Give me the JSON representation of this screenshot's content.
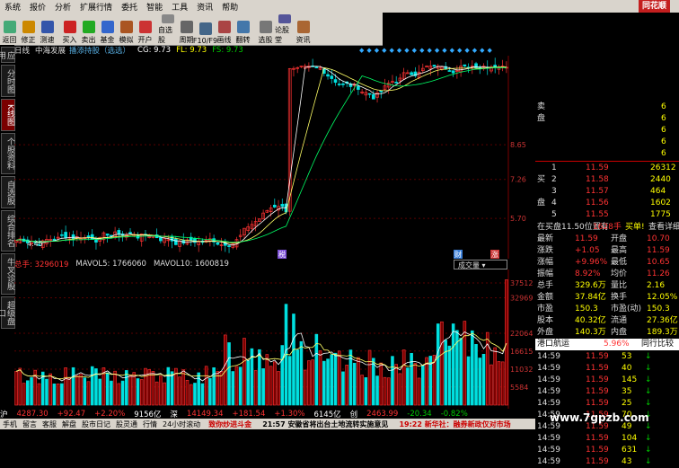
{
  "menu": [
    "系统",
    "报价",
    "分析",
    "扩展行情",
    "委托",
    "智能",
    "工具",
    "资讯",
    "帮助"
  ],
  "brand": "同花顺",
  "toolbar": [
    {
      "label": "返回",
      "color": "#4a7"
    },
    {
      "label": "修正",
      "color": "#c80"
    },
    {
      "label": "测速",
      "color": "#35a"
    },
    {
      "label": "买入",
      "color": "#c22"
    },
    {
      "label": "卖出",
      "color": "#2a2"
    },
    {
      "label": "基金",
      "color": "#36c"
    },
    {
      "label": "模拟",
      "color": "#a52"
    },
    {
      "label": "开户",
      "color": "#c33"
    },
    {
      "label": "自选股",
      "color": "#888"
    },
    {
      "label": "周期",
      "color": "#666"
    },
    {
      "label": "F10/F9",
      "color": "#468"
    },
    {
      "label": "画线",
      "color": "#a44"
    },
    {
      "label": "翻转",
      "color": "#47a"
    },
    {
      "label": "选股",
      "color": "#777"
    },
    {
      "label": "论股堂",
      "color": "#559"
    },
    {
      "label": "资讯",
      "color": "#a63"
    }
  ],
  "left_nav": [
    "应用",
    "分时图",
    "K线图",
    "个股资料",
    "自选股",
    "综合排名",
    "牛叉诊股",
    "超级盘口"
  ],
  "info": {
    "period": "日线",
    "stock_name": "中海发展",
    "ann": "播添持股（选选）",
    "cg": "CG: 9.73",
    "fl": "FL: 9.73",
    "fs": "FS: 9.73"
  },
  "vol_header": {
    "total": "总手: 3296019",
    "mavol5": "MAVOL5: 1766060",
    "mavol10": "MAVOL10: 1600819",
    "dropdown": "成交量"
  },
  "bottom_index": [
    {
      "text": "沪",
      "color": "#fff"
    },
    {
      "text": "4287.30",
      "color": "#f33"
    },
    {
      "text": "+92.47",
      "color": "#f33"
    },
    {
      "text": "+2.20%",
      "color": "#f33"
    },
    {
      "text": "9156亿",
      "color": "#fff"
    },
    {
      "text": "深",
      "color": "#fff"
    },
    {
      "text": "14149.34",
      "color": "#f33"
    },
    {
      "text": "+181.54",
      "color": "#f33"
    },
    {
      "text": "+1.30%",
      "color": "#f33"
    },
    {
      "text": "6145亿",
      "color": "#fff"
    },
    {
      "text": "创",
      "color": "#fff"
    },
    {
      "text": "2463.99",
      "color": "#f33"
    },
    {
      "text": "-20.34",
      "color": "#0c0"
    },
    {
      "text": "-0.82%",
      "color": "#0c0"
    }
  ],
  "bottom_tabs": [
    "手机",
    "留言",
    "客服",
    "解盘",
    "股市日记",
    "股灵通",
    "行情",
    "24小时滚动"
  ],
  "news": {
    "n1": "致你炒进斗金",
    "mid": "21:57 安徽省将出台土地流转实施意见",
    "n2": "19:22 新华社：融券新政仅对市场"
  },
  "watermark": "www.7gpzb.com",
  "price_axis": [
    "8.65",
    "7.26",
    "5.70"
  ],
  "vol_axis": [
    "37512",
    "32969",
    "22064",
    "16615",
    "11032",
    "5584"
  ],
  "markers": {
    "m1": "税",
    "m2": "财",
    "m3": "涨",
    "low": "4.45"
  },
  "orderbook": {
    "sell_label": "卖",
    "buy_label": "买",
    "pan": "盘",
    "sells": [
      {
        "lvl": "",
        "price": "",
        "vol": "6"
      },
      {
        "lvl": "",
        "price": "",
        "vol": "6"
      },
      {
        "lvl": "",
        "price": "",
        "vol": "6"
      },
      {
        "lvl": "",
        "price": "",
        "vol": "6"
      },
      {
        "lvl": "",
        "price": "",
        "vol": "6"
      }
    ],
    "buys": [
      {
        "lvl": "1",
        "price": "11.59",
        "vol": "26312"
      },
      {
        "lvl": "2",
        "price": "11.58",
        "vol": "2440"
      },
      {
        "lvl": "3",
        "price": "11.57",
        "vol": "464"
      },
      {
        "lvl": "4",
        "price": "11.56",
        "vol": "1602"
      },
      {
        "lvl": "5",
        "price": "11.55",
        "vol": "1775"
      }
    ]
  },
  "order_note": {
    "a": "在买盘11.50位置有",
    "b": "1628手",
    "c": "买单!",
    "d": "查看详细"
  },
  "quote": [
    [
      "最新",
      "11.59",
      "开盘",
      "10.70"
    ],
    [
      "涨跌",
      "+1.05",
      "最高",
      "11.59"
    ],
    [
      "涨幅",
      "+9.96%",
      "最低",
      "10.65"
    ],
    [
      "振幅",
      "8.92%",
      "均价",
      "11.26"
    ],
    [
      "总手",
      "329.6万",
      "量比",
      "2.16"
    ],
    [
      "金额",
      "37.84亿",
      "换手",
      "12.05%"
    ],
    [
      "市盈",
      "150.3",
      "市盈(动)",
      "150.3"
    ],
    [
      "股本",
      "40.32亿",
      "流通",
      "27.36亿"
    ],
    [
      "外盘",
      "140.3万",
      "内盘",
      "189.3万"
    ]
  ],
  "sector": {
    "name": "港口航运",
    "pct": "5.96%",
    "link": "同行比较"
  },
  "ticks": [
    [
      "14:59",
      "11.59",
      "53"
    ],
    [
      "14:59",
      "11.59",
      "40"
    ],
    [
      "14:59",
      "11.59",
      "145"
    ],
    [
      "14:59",
      "11.59",
      "35"
    ],
    [
      "14:59",
      "11.59",
      "25"
    ],
    [
      "14:59",
      "11.59",
      "70"
    ],
    [
      "14:59",
      "11.59",
      "49"
    ],
    [
      "14:59",
      "11.59",
      "104"
    ],
    [
      "14:59",
      "11.59",
      "631"
    ],
    [
      "14:59",
      "11.59",
      "43"
    ]
  ],
  "side_chars": "m5"
}
